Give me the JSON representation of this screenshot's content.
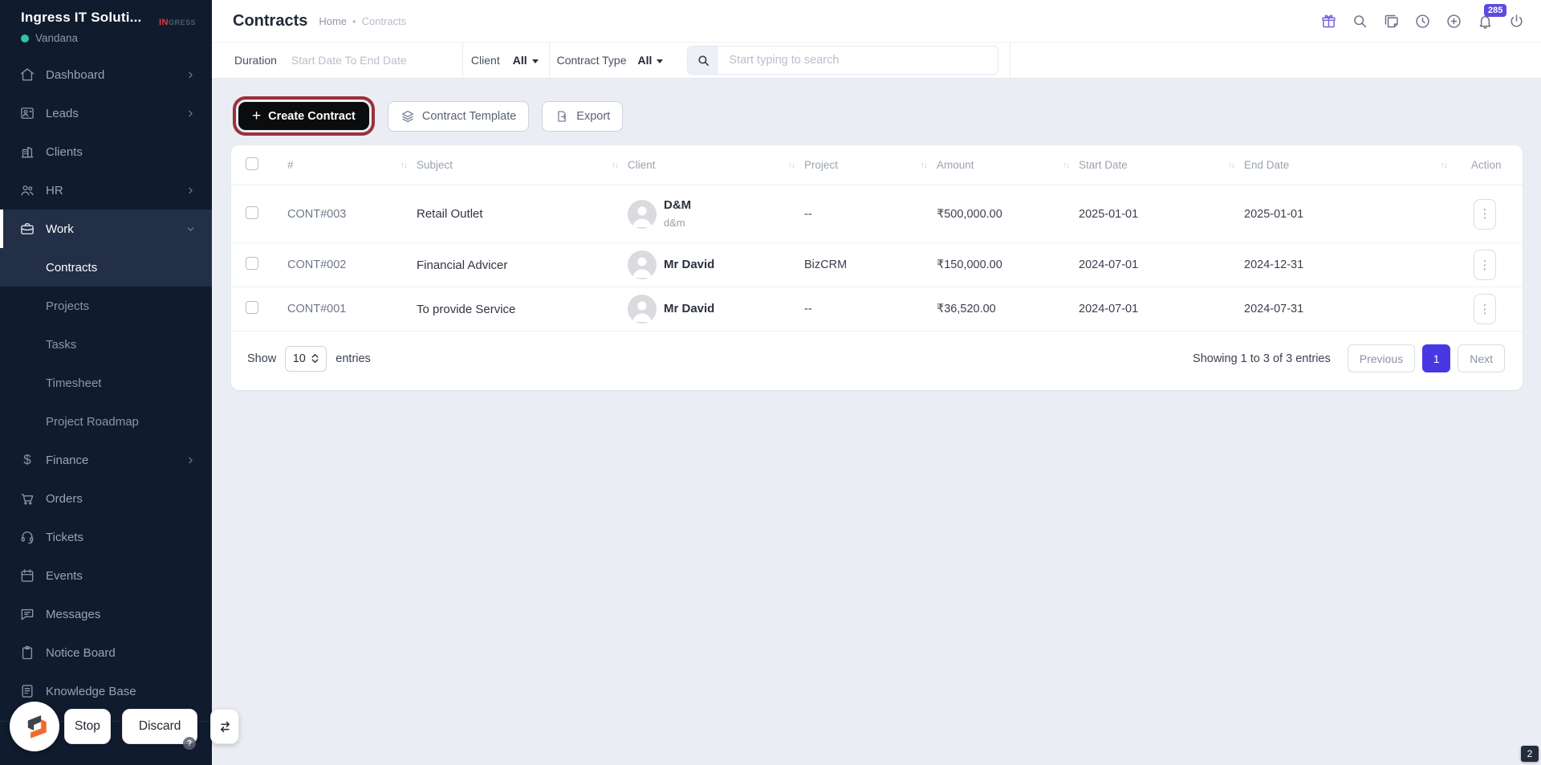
{
  "sidebar": {
    "company": "Ingress IT Soluti...",
    "user": "Vandana",
    "logo_primary": "IN",
    "logo_secondary": "GRESS",
    "items": [
      {
        "label": "Dashboard"
      },
      {
        "label": "Leads"
      },
      {
        "label": "Clients"
      },
      {
        "label": "HR"
      },
      {
        "label": "Work"
      },
      {
        "label": "Finance"
      },
      {
        "label": "Orders"
      },
      {
        "label": "Tickets"
      },
      {
        "label": "Events"
      },
      {
        "label": "Messages"
      },
      {
        "label": "Notice Board"
      },
      {
        "label": "Knowledge Base"
      }
    ],
    "work_submenu": [
      {
        "label": "Contracts"
      },
      {
        "label": "Projects"
      },
      {
        "label": "Tasks"
      },
      {
        "label": "Timesheet"
      },
      {
        "label": "Project Roadmap"
      }
    ]
  },
  "header": {
    "title": "Contracts",
    "breadcrumb": {
      "home": "Home",
      "separator": "•",
      "current": "Contracts"
    },
    "notification_count": "285"
  },
  "filters": {
    "duration_label": "Duration",
    "duration_placeholder": "Start Date To End Date",
    "client_label": "Client",
    "client_value": "All",
    "contract_type_label": "Contract Type",
    "contract_type_value": "All",
    "search_placeholder": "Start typing to search"
  },
  "toolbar": {
    "create_label": "Create Contract",
    "template_label": "Contract Template",
    "export_label": "Export"
  },
  "table": {
    "columns": {
      "id": "#",
      "subject": "Subject",
      "client": "Client",
      "project": "Project",
      "amount": "Amount",
      "start": "Start Date",
      "end": "End Date",
      "action": "Action"
    },
    "rows": [
      {
        "id": "CONT#003",
        "subject": "Retail Outlet",
        "client_name": "D&M",
        "client_subtitle": "d&m",
        "project": "--",
        "amount": "₹500,000.00",
        "start_date": "2025-01-01",
        "end_date": "2025-01-01"
      },
      {
        "id": "CONT#002",
        "subject": "Financial Advicer",
        "client_name": "Mr David",
        "client_subtitle": "",
        "project": "BizCRM",
        "amount": "₹150,000.00",
        "start_date": "2024-07-01",
        "end_date": "2024-12-31"
      },
      {
        "id": "CONT#001",
        "subject": "To provide Service",
        "client_name": "Mr David",
        "client_subtitle": "",
        "project": "--",
        "amount": "₹36,520.00",
        "start_date": "2024-07-01",
        "end_date": "2024-07-31"
      }
    ]
  },
  "pagination": {
    "show_label": "Show",
    "page_size": "10",
    "entries_label": "entries",
    "summary": "Showing 1 to 3 of 3 entries",
    "previous_label": "Previous",
    "current_page": "1",
    "next_label": "Next"
  },
  "overlay": {
    "stop_label": "Stop",
    "discard_label": "Discard",
    "corner_badge": "2",
    "help_glyph": "?"
  },
  "icons": {
    "sort": "↑↓",
    "kebab": "⋮",
    "plus": "+",
    "dollar": "$"
  },
  "colors": {
    "accent": "#4838e4",
    "sidebar_bg": "#101b2e",
    "sidebar_active": "#232e47",
    "ring": "#9c3038",
    "badge": "#5b4be0",
    "green": "#2ec4a5",
    "createbg": "#0b0c0e"
  }
}
